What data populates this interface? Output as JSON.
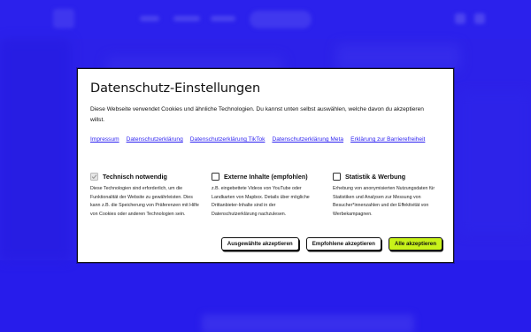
{
  "colors": {
    "backdrop": "#2a1ff0",
    "link": "#2a1ff0",
    "accent_button": "#c8f21a",
    "text": "#111111"
  },
  "modal": {
    "title": "Datenschutz-Einstellungen",
    "intro": "Diese Webseite verwendet Cookies und ähnliche Technologien. Du kannst unten selbst auswählen, welche davon du akzeptieren willst.",
    "links": [
      "Impressum",
      "Datenschutzerklärung",
      "Datenschutzerklärung TikTok",
      "Datenschutzerklärung Meta",
      "Erklärung zur Barrierefreiheit"
    ],
    "categories": [
      {
        "title": "Technisch notwendig",
        "checked": true,
        "disabled": true,
        "description": "Diese Technologien sind erforderlich, um die Funktionalität der Website zu gewährleisten. Dies kann z.B. die Speicherung von Präferenzen mit Hilfe von Cookies oder anderen Technologien sein."
      },
      {
        "title": "Externe Inhalte (empfohlen)",
        "checked": false,
        "disabled": false,
        "description": "z.B. eingebettete Videos von YouTube oder Landkarten von Mapbox. Details über mögliche Drittanbieter-Inhalte sind in der Datenschutzerklärung nachzulesen."
      },
      {
        "title": "Statistik & Werbung",
        "checked": false,
        "disabled": false,
        "description": "Erhebung von anonymisierten Nutzungsdaten für Statistiken und Analysen zur Messung von Besucher*innenzahlen und der Effektivität von Werbekampagnen."
      }
    ],
    "buttons": {
      "accept_selected": "Ausgewählte akzeptieren",
      "accept_recommended": "Empfohlene akzeptieren",
      "accept_all": "Alle akzeptieren"
    }
  },
  "icons": {
    "checkbox_check": "check-icon"
  }
}
